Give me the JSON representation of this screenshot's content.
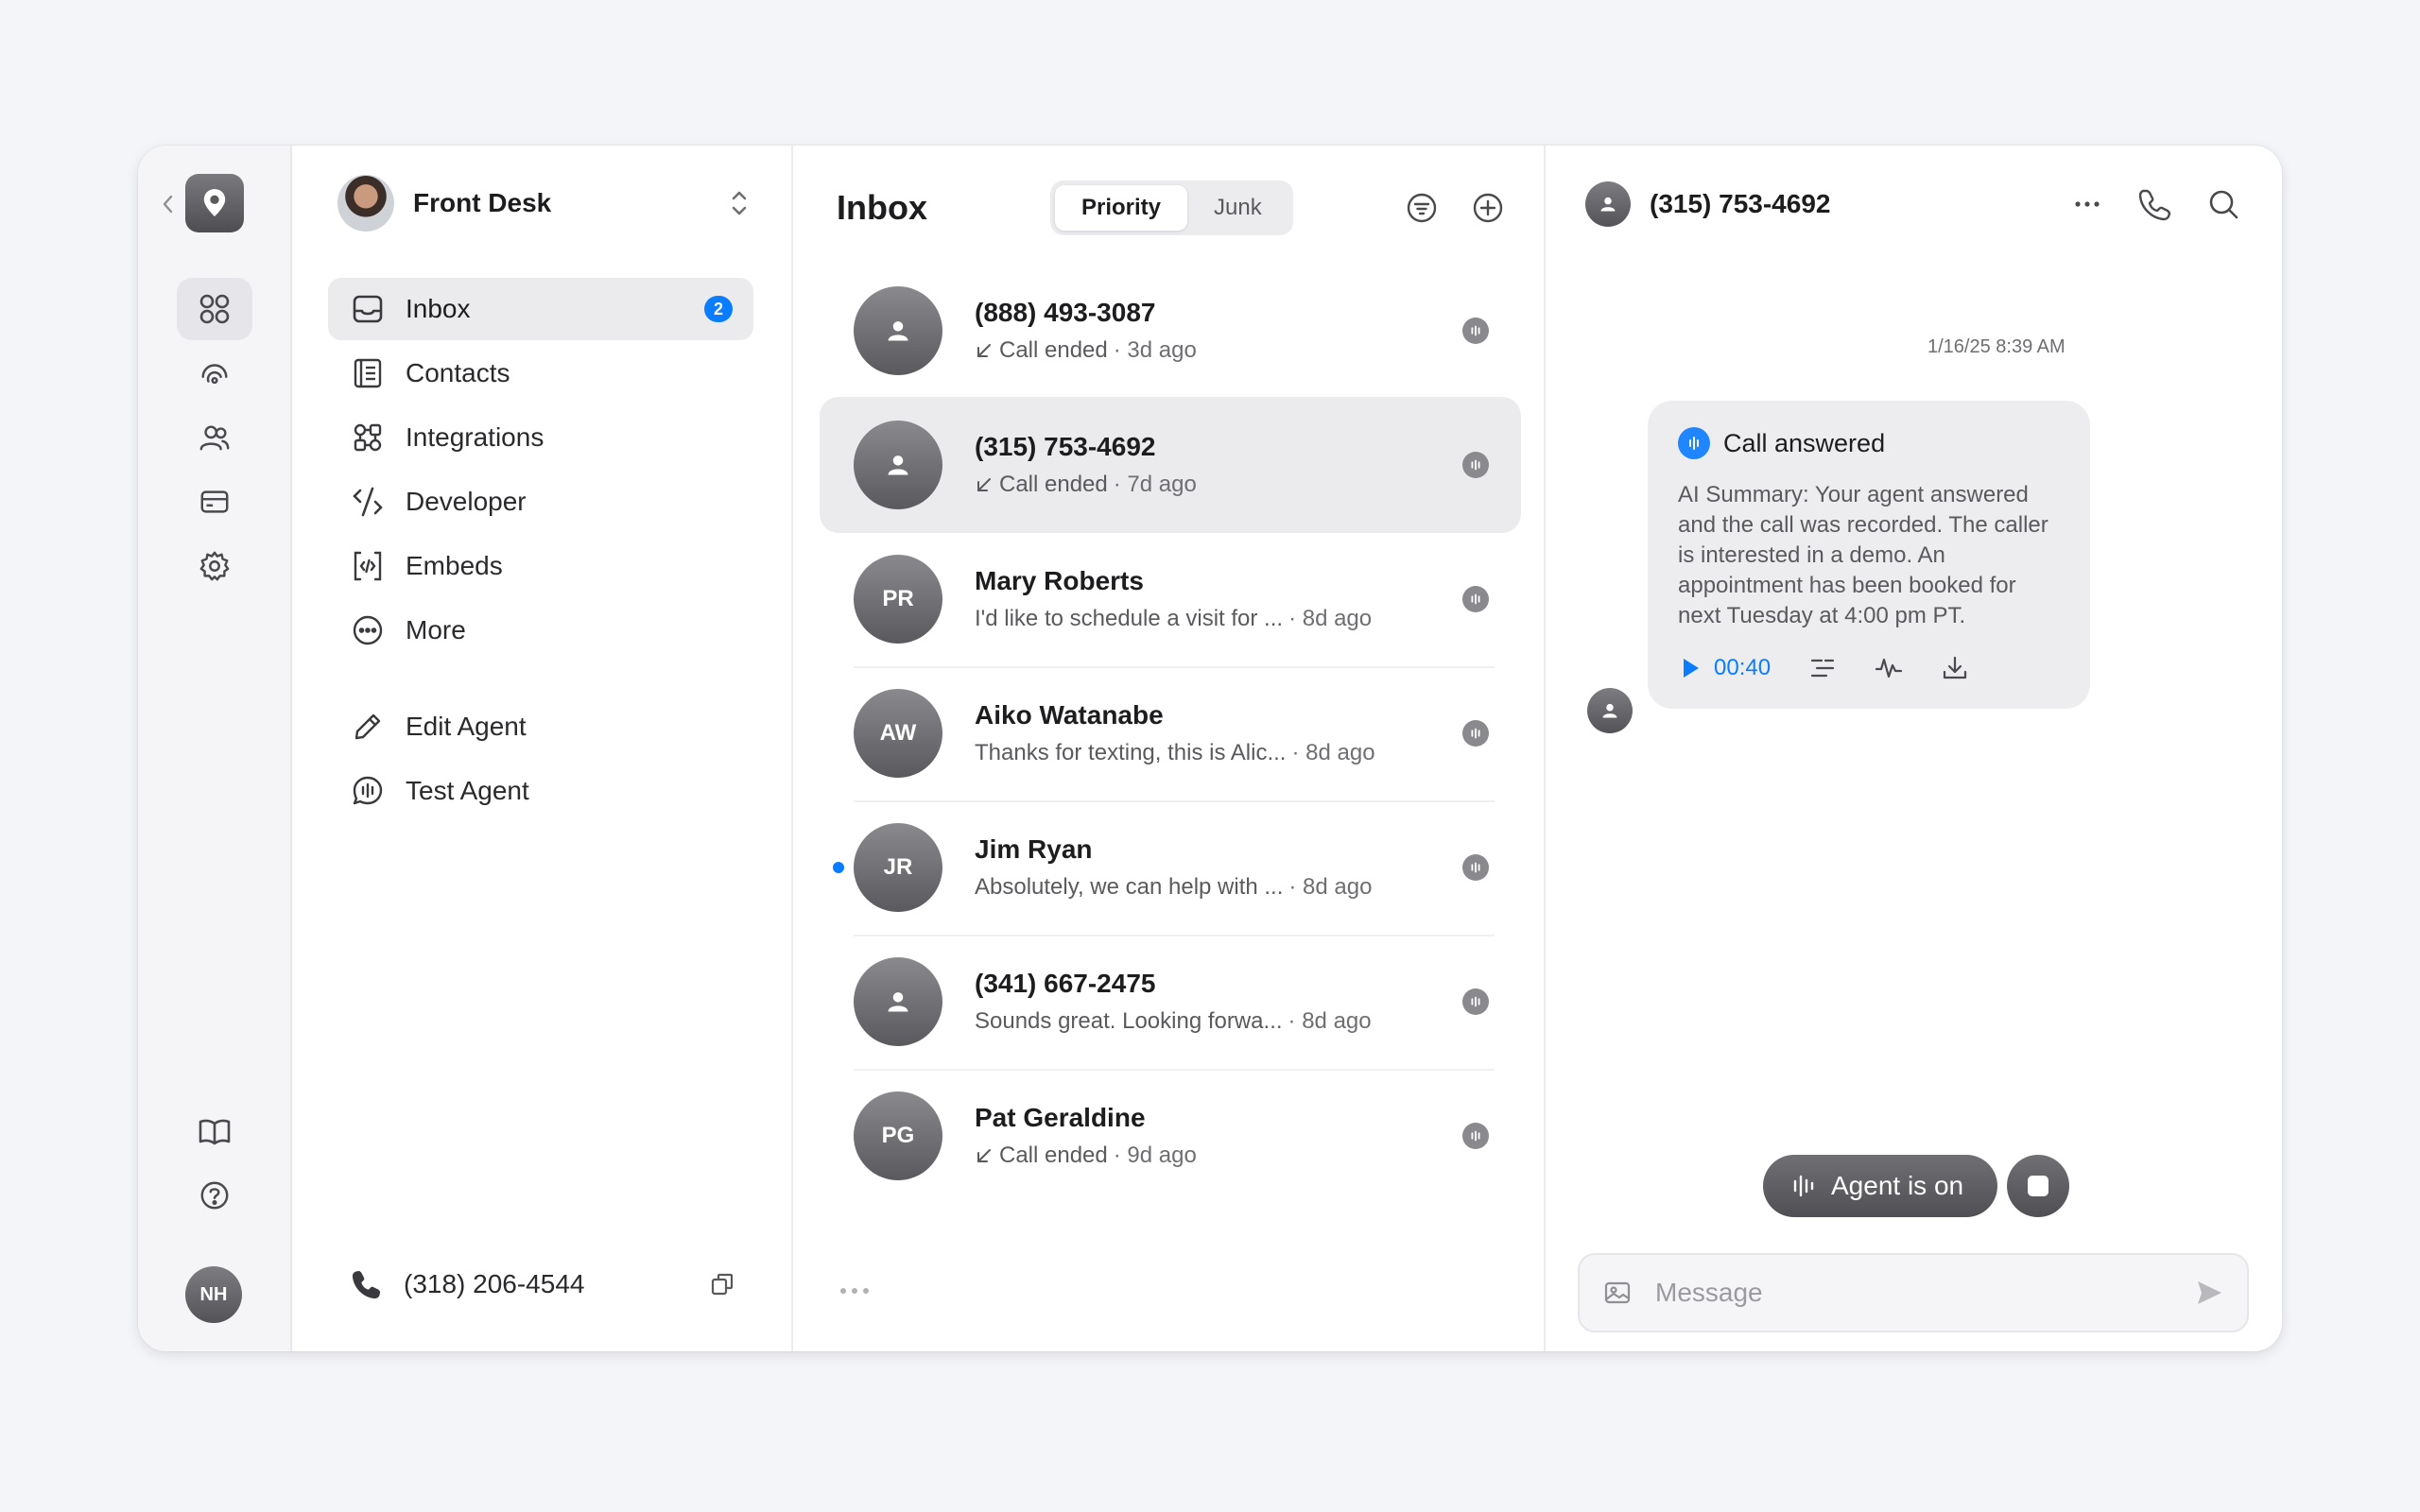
{
  "workspace": {
    "name": "Front Desk"
  },
  "rail": {
    "avatar_initials": "NH",
    "icons": [
      "grid-icon",
      "activity-icon",
      "users-icon",
      "billing-icon",
      "settings-icon",
      "book-icon",
      "help-icon"
    ]
  },
  "nav": {
    "items": [
      {
        "label": "Inbox",
        "icon": "inbox-icon",
        "badge": "2",
        "active": true
      },
      {
        "label": "Contacts",
        "icon": "contacts-icon"
      },
      {
        "label": "Integrations",
        "icon": "integrations-icon"
      },
      {
        "label": "Developer",
        "icon": "developer-icon"
      },
      {
        "label": "Embeds",
        "icon": "embeds-icon"
      },
      {
        "label": "More",
        "icon": "more-icon"
      },
      {
        "label": "Edit Agent",
        "icon": "pencil-icon"
      },
      {
        "label": "Test Agent",
        "icon": "chat-icon"
      }
    ],
    "phone_number": "(318) 206-4544"
  },
  "inbox": {
    "title": "Inbox",
    "tabs": [
      {
        "label": "Priority",
        "active": true
      },
      {
        "label": "Junk"
      }
    ],
    "conversations": [
      {
        "name": "(888) 493-3087",
        "avatar": "",
        "preview": "Call ended",
        "call": true,
        "time": "· 3d ago"
      },
      {
        "name": "(315) 753-4692",
        "avatar": "",
        "preview": "Call ended",
        "call": true,
        "time": "· 7d ago",
        "selected": true
      },
      {
        "name": "Mary Roberts",
        "avatar": "PR",
        "preview": "I'd like to schedule a visit for ...",
        "time": "· 8d ago"
      },
      {
        "name": "Aiko Watanabe",
        "avatar": "AW",
        "preview": "Thanks for texting, this is Alic...",
        "time": "· 8d ago"
      },
      {
        "name": "Jim Ryan",
        "avatar": "JR",
        "preview": "Absolutely, we can help with ...",
        "time": "· 8d ago",
        "unread": true
      },
      {
        "name": "(341) 667-2475",
        "avatar": "",
        "preview": "Sounds great. Looking forwa...",
        "time": "· 8d ago"
      },
      {
        "name": "Pat Geraldine",
        "avatar": "PG",
        "preview": "Call ended",
        "call": true,
        "time": "· 9d ago"
      }
    ]
  },
  "thread": {
    "contact": "(315) 753-4692",
    "timestamp": "1/16/25 8:39 AM",
    "message": {
      "title": "Call answered",
      "summary": "AI Summary: Your agent answered and the call was recorded. The caller is interested in a demo. An appointment has been booked for next Tuesday at 4:00 pm PT.",
      "duration": "00:40"
    },
    "agent_status": "Agent is on",
    "composer_placeholder": "Message"
  },
  "colors": {
    "accent": "#0a7cff",
    "avatar_gray": "#6e6e72",
    "selected_row": "#ebebee"
  }
}
